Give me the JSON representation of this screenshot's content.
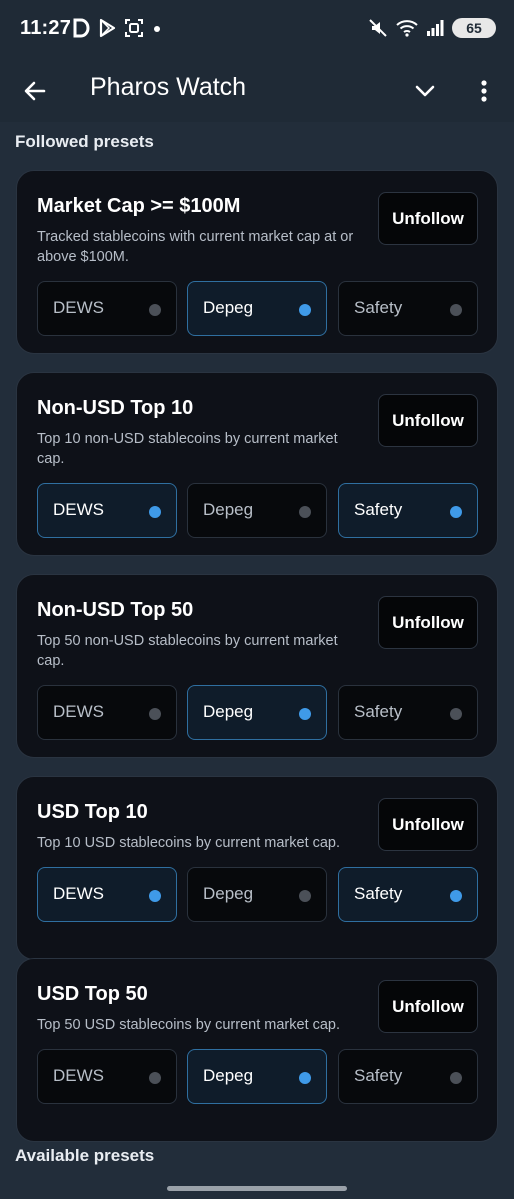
{
  "status_bar": {
    "time": "11:27",
    "battery": "65",
    "icons_left": [
      "d-app-icon",
      "play-store-icon",
      "screen-capture-icon",
      "dot-icon"
    ],
    "icons_right": [
      "mute-icon",
      "wifi-icon",
      "signal-icon",
      "battery-icon"
    ]
  },
  "app_bar": {
    "title": "Pharos Watch",
    "back_icon": "arrow-left-icon",
    "dropdown_icon": "chevron-down-icon",
    "menu_icon": "more-vert-icon"
  },
  "sections": {
    "followed": "Followed presets",
    "available": "Available presets"
  },
  "presets": [
    {
      "title": "Market Cap >= $100M",
      "description": "Tracked stablecoins with current market cap at or above $100M.",
      "button": "Unfollow",
      "toggles": [
        {
          "label": "DEWS",
          "on": false
        },
        {
          "label": "Depeg",
          "on": true
        },
        {
          "label": "Safety",
          "on": false
        }
      ]
    },
    {
      "title": "Non-USD Top 10",
      "description": "Top 10 non-USD stablecoins by current market cap.",
      "button": "Unfollow",
      "toggles": [
        {
          "label": "DEWS",
          "on": true
        },
        {
          "label": "Depeg",
          "on": false
        },
        {
          "label": "Safety",
          "on": true
        }
      ]
    },
    {
      "title": "Non-USD Top 50",
      "description": "Top 50 non-USD stablecoins by current market cap.",
      "button": "Unfollow",
      "toggles": [
        {
          "label": "DEWS",
          "on": false
        },
        {
          "label": "Depeg",
          "on": true
        },
        {
          "label": "Safety",
          "on": false
        }
      ]
    },
    {
      "title": "USD Top 10",
      "description": "Top 10 USD stablecoins by current market cap.",
      "button": "Unfollow",
      "toggles": [
        {
          "label": "DEWS",
          "on": true
        },
        {
          "label": "Depeg",
          "on": false
        },
        {
          "label": "Safety",
          "on": true
        }
      ]
    },
    {
      "title": "USD Top 50",
      "description": "Top 50 USD stablecoins by current market cap.",
      "button": "Unfollow",
      "toggles": [
        {
          "label": "DEWS",
          "on": false
        },
        {
          "label": "Depeg",
          "on": true
        },
        {
          "label": "Safety",
          "on": false
        }
      ]
    }
  ],
  "colors": {
    "background": "#222d3a",
    "card": "#0e1118",
    "accent": "#3f9ae8",
    "toggle_on_bg": "#0f1c2a",
    "toggle_on_border": "#2f6fa0"
  }
}
